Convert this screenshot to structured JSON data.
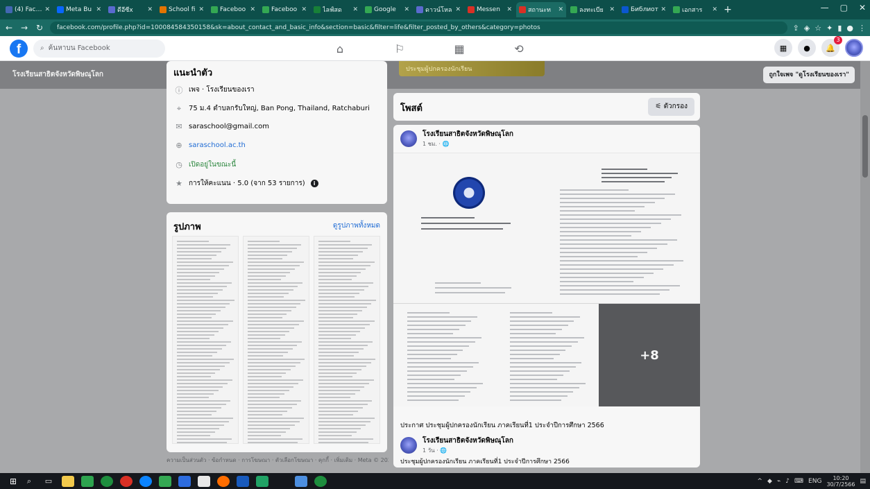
{
  "browser": {
    "tabs": [
      {
        "title": "(4) Faceb",
        "color": "#4267b2",
        "active": false
      },
      {
        "title": "Meta Bu",
        "color": "#0866ff",
        "active": false
      },
      {
        "title": "ดีอีซีx",
        "color": "#5a6acf",
        "active": false
      },
      {
        "title": "School fi",
        "color": "#e37400",
        "active": false
      },
      {
        "title": "Faceboo",
        "color": "#34a853",
        "active": false
      },
      {
        "title": "Faceboo",
        "color": "#34a853",
        "active": false
      },
      {
        "title": "ไลฟ์สด",
        "color": "#188038",
        "active": false
      },
      {
        "title": "Google",
        "color": "#34a853",
        "active": false
      },
      {
        "title": "ดาวน์โหล",
        "color": "#5a6acf",
        "active": false
      },
      {
        "title": "Messen",
        "color": "#d93025",
        "active": false
      },
      {
        "title": "สถานะท",
        "color": "#d93025",
        "active": true
      },
      {
        "title": "ลงทะเบีย",
        "color": "#34a853",
        "active": false
      },
      {
        "title": "Библиот",
        "color": "#0b57d0",
        "active": false
      },
      {
        "title": "เอกสาร",
        "color": "#34a853",
        "active": false
      }
    ],
    "new_tab": "+",
    "url": "facebook.com/profile.php?id=100084584350158&sk=about_contact_and_basic_info&section=basic&filter=life&filter_posted_by_others&category=photos",
    "window_controls": [
      "—",
      "▢",
      "✕"
    ]
  },
  "facebook": {
    "logo": "f",
    "search_placeholder": "ค้นหาบน Facebook",
    "notifications_count": "3"
  },
  "cover": {
    "page_name_strip": "โรงเรียนสาธิตจังหวัดพิษณุโลก",
    "cover_text": "ประชุมผู้ปกครองนักเรียน",
    "like_button": "ถูกใจเพจ \"ดูโรงเรียนของเรา\""
  },
  "intro": {
    "title": "แนะนำตัว",
    "rows": [
      {
        "icon": "info-icon",
        "text": "เพจ · โรงเรียนของเรา"
      },
      {
        "icon": "location-icon",
        "text": "75 ม.4 ตำบลกรับใหญ่, Ban Pong, Thailand, Ratchaburi"
      },
      {
        "icon": "email-icon",
        "text": "saraschool@gmail.com"
      },
      {
        "icon": "website-icon",
        "text": "saraschool.ac.th"
      },
      {
        "icon": "clock-icon",
        "text": "เปิดอยู่ในขณะนี้"
      },
      {
        "icon": "star-icon",
        "text": "การให้คะแนน · 5.0 (จาก 53 รายการ)"
      }
    ]
  },
  "photos": {
    "title": "รูปภาพ",
    "see_all": "ดูรูปภาพทั้งหมด"
  },
  "footer": "ความเป็นส่วนตัว · ข้อกำหนด · การโฆษณา · ตัวเลือกโฆษณา · คุกกี้ · เพิ่มเติม · Meta © 2023",
  "posts": {
    "title": "โพสต์",
    "filter_button": "ตัวกรอง",
    "post": {
      "author": "โรงเรียนสาธิตจังหวัดพิษณุโลก",
      "meta": "1 ชม. · 🌐",
      "more_photos": "+8",
      "caption": "ประกาศ ประชุมผู้ปกครองนักเรียน ภาคเรียนที่1 ประจำปีการศึกษา 2566"
    },
    "post2": {
      "author": "โรงเรียนสาธิตจังหวัดพิษณุโลก",
      "meta": "1 วัน · 🌐",
      "text": "ประชุมผู้ปกครองนักเรียน ภาคเรียนที่1 ประจำปีการศึกษา 2566"
    }
  },
  "taskbar": {
    "lang": "ENG",
    "time": "10:20",
    "date": "30/7/2566"
  }
}
